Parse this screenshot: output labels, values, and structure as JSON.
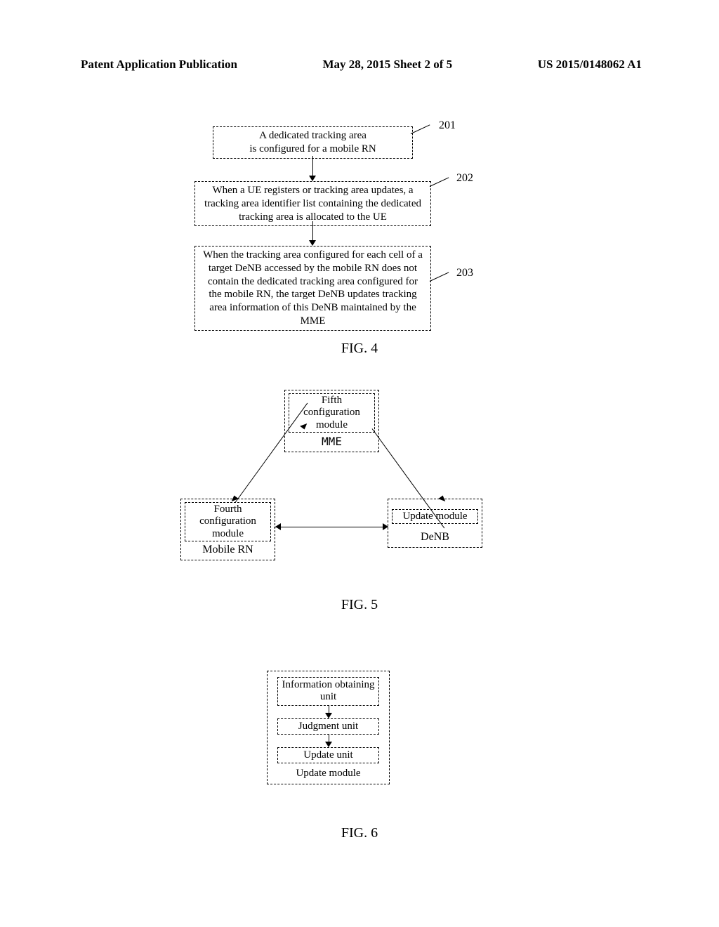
{
  "header": {
    "left": "Patent Application Publication",
    "center": "May 28, 2015  Sheet 2 of 5",
    "right": "US 2015/0148062 A1"
  },
  "fig4": {
    "step1": "A dedicated tracking area\nis configured for a mobile RN",
    "step2": "When a UE registers or tracking area updates, a tracking area identifier list containing the dedicated tracking area is allocated to the UE",
    "step3": "When the tracking area configured for each cell of a target DeNB accessed by the mobile RN does not contain the dedicated tracking area configured for the mobile RN, the target DeNB updates tracking area information of this DeNB maintained by the MME",
    "label201": "201",
    "label202": "202",
    "label203": "203",
    "caption": "FIG. 4"
  },
  "fig5": {
    "mme_inner": "Fifth configuration module",
    "mme_label": "MME",
    "rn_inner": "Fourth configuration module",
    "rn_label": "Mobile RN",
    "denb_inner": "Update module",
    "denb_label": "DeNB",
    "caption": "FIG. 5"
  },
  "fig6": {
    "unit1": "Information obtaining unit",
    "unit2": "Judgment unit",
    "unit3": "Update unit",
    "outer_label": "Update module",
    "caption": "FIG. 6"
  }
}
